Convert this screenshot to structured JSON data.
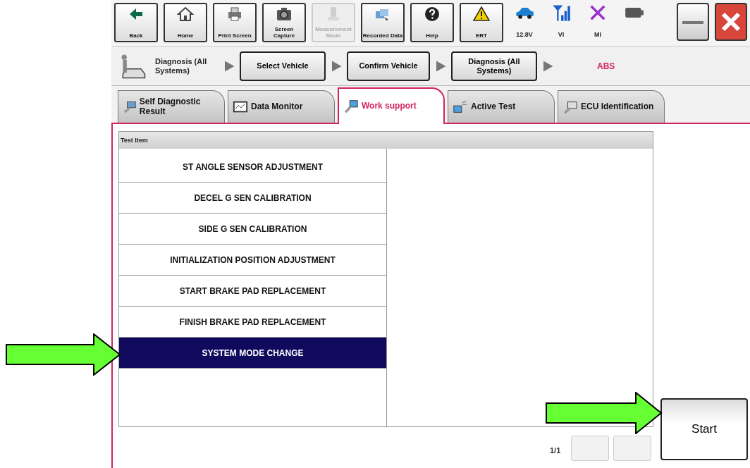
{
  "toolbar": {
    "buttons": [
      {
        "kind": "back",
        "label": "Back",
        "disabled": false
      },
      {
        "kind": "home",
        "label": "Home",
        "disabled": false
      },
      {
        "kind": "print",
        "label": "Print Screen",
        "disabled": false
      },
      {
        "kind": "camera",
        "label": "Screen Capture",
        "disabled": false
      },
      {
        "kind": "measure",
        "label": "Measurement Mode",
        "disabled": true
      },
      {
        "kind": "recorded",
        "label": "Recorded Data",
        "disabled": false
      },
      {
        "kind": "help",
        "label": "Help",
        "disabled": false
      },
      {
        "kind": "ert",
        "label": "ERT",
        "disabled": false
      }
    ],
    "status": [
      {
        "kind": "car",
        "label": "12.8V"
      },
      {
        "kind": "signal",
        "label": "VI"
      },
      {
        "kind": "cross",
        "label": "MI"
      },
      {
        "kind": "battery"
      }
    ]
  },
  "breadcrumb": {
    "root": "Diagnosis (All Systems)",
    "steps": [
      "Select Vehicle",
      "Confirm Vehicle",
      "Diagnosis (All Systems)"
    ],
    "current": "ABS"
  },
  "tabs": [
    {
      "kind": "selfdiag",
      "label": "Self Diagnostic Result",
      "selected": false
    },
    {
      "kind": "monitor",
      "label": "Data Monitor",
      "selected": false
    },
    {
      "kind": "work",
      "label": "Work support",
      "selected": true
    },
    {
      "kind": "active",
      "label": "Active Test",
      "selected": false
    },
    {
      "kind": "ecu",
      "label": "ECU Identification",
      "selected": false
    }
  ],
  "table": {
    "column_1": "Test Item",
    "items": [
      {
        "label": "ST ANGLE SENSOR ADJUSTMENT",
        "selected": false
      },
      {
        "label": "DECEL G SEN CALIBRATION",
        "selected": false
      },
      {
        "label": "SIDE G SEN CALIBRATION",
        "selected": false
      },
      {
        "label": "INITIALIZATION POSITION ADJUSTMENT",
        "selected": false
      },
      {
        "label": "START BRAKE PAD REPLACEMENT",
        "selected": false
      },
      {
        "label": "FINISH BRAKE PAD REPLACEMENT",
        "selected": false
      },
      {
        "label": "SYSTEM MODE CHANGE",
        "selected": true
      }
    ]
  },
  "pager": "1/1",
  "start_button": "Start"
}
